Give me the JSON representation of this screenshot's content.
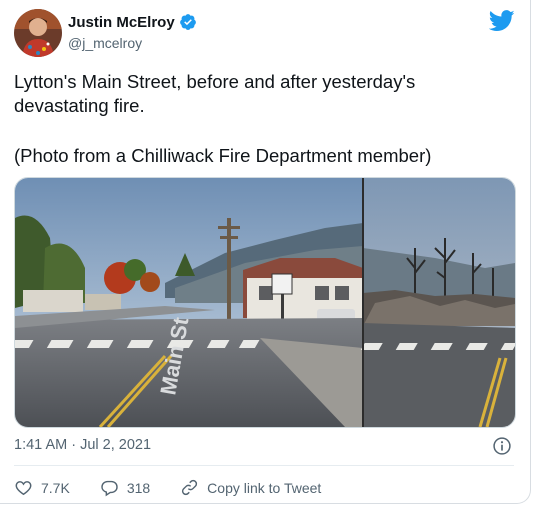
{
  "author": {
    "name": "Justin McElroy",
    "handle": "@j_mcelroy",
    "verified": true
  },
  "tweet": {
    "line1": "Lytton's Main Street, before and after yesterday's devastating fire.",
    "line2": "(Photo from a Chilliwack Fire Department member)"
  },
  "photo": {
    "street_sign_text": "Main St"
  },
  "meta": {
    "timestamp": "1:41 AM · Jul 2, 2021"
  },
  "actions": {
    "likes": "7.7K",
    "replies": "318",
    "copy_link": "Copy link to Tweet"
  },
  "colors": {
    "brand_blue": "#1d9bf0",
    "secondary_text": "#536471",
    "primary_text": "#0f1419"
  }
}
